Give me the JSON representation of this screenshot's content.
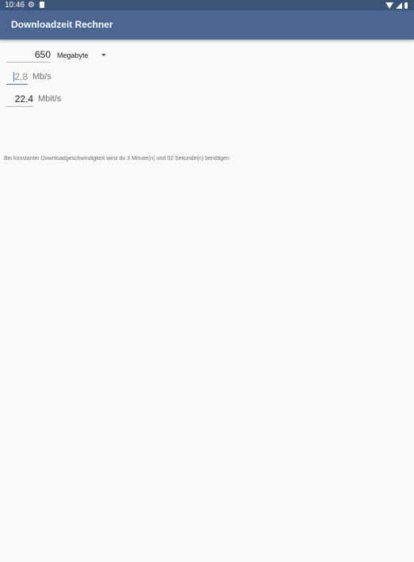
{
  "status_bar": {
    "time": "10:46",
    "left_icons": [
      "gear-icon",
      "sd-card-icon"
    ],
    "right_icons": [
      "wifi-icon",
      "signal-icon",
      "battery-icon"
    ]
  },
  "app_bar": {
    "title": "Downloadzeit Rechner",
    "color": "#4a6691",
    "status_color": "#3b5377"
  },
  "form": {
    "size_value": "650",
    "size_unit": "Megabyte",
    "speed_mb_value": "2.8",
    "speed_mb_unit": "Mb/s",
    "speed_mbit_value": "22.4",
    "speed_mbit_unit": "Mbit/s"
  },
  "result": {
    "text": "Bei konstanter Downloadgeschwindigkeit wirst du 3 Minute(n) und 52 Sekunde(n) benötigen"
  },
  "colors": {
    "background": "#fafafa",
    "accent": "#4a6fb5"
  }
}
